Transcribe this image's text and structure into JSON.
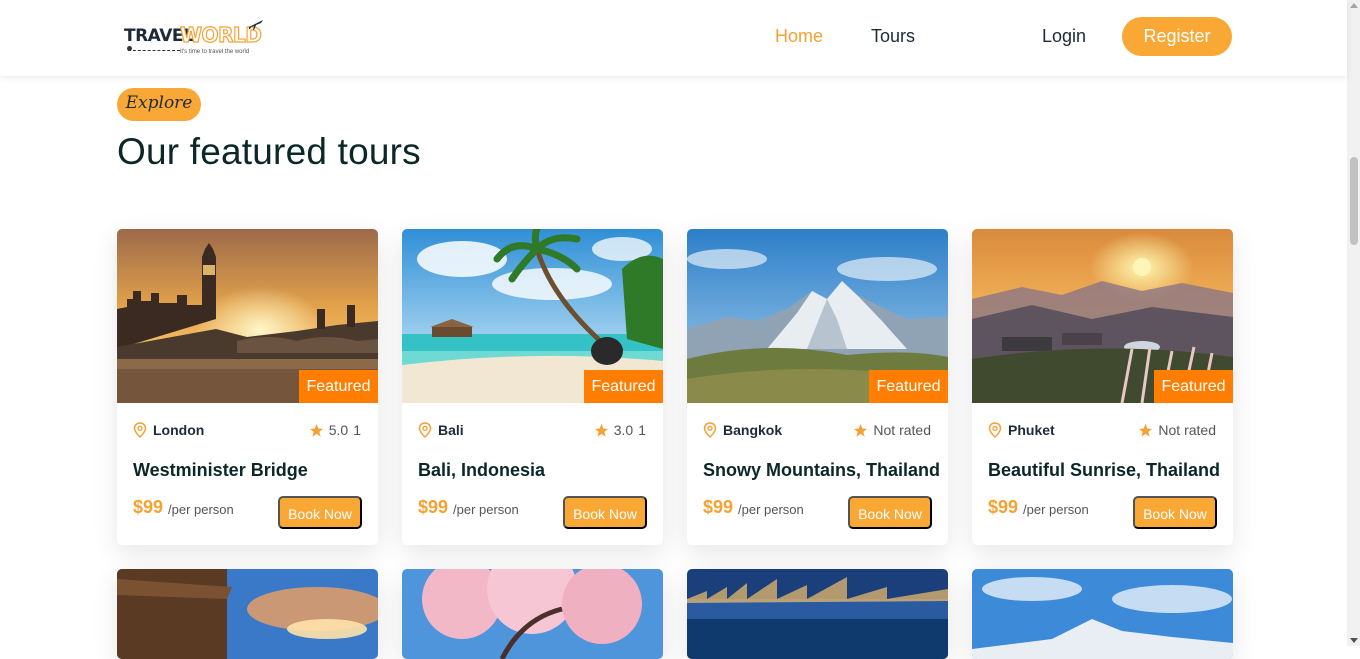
{
  "header": {
    "logo": {
      "travel": "TRAVEL",
      "world": "WORLD",
      "tagline": "it's time to travel the world"
    },
    "nav": [
      {
        "label": "Home",
        "active": true
      },
      {
        "label": "Tours",
        "active": false
      }
    ],
    "login_label": "Login",
    "register_label": "Register"
  },
  "section": {
    "badge": "Explore",
    "title": "Our featured tours"
  },
  "tours": [
    {
      "featured_label": "Featured",
      "city": "London",
      "rating": "5.0",
      "reviews": "1",
      "title": "Westminister Bridge",
      "price": "$99",
      "per": "/per person",
      "book_label": "Book Now"
    },
    {
      "featured_label": "Featured",
      "city": "Bali",
      "rating": "3.0",
      "reviews": "1",
      "title": "Bali, Indonesia",
      "price": "$99",
      "per": "/per person",
      "book_label": "Book Now"
    },
    {
      "featured_label": "Featured",
      "city": "Bangkok",
      "rating": "Not rated",
      "reviews": "",
      "title": "Snowy Mountains, Thailand",
      "price": "$99",
      "per": "/per person",
      "book_label": "Book Now"
    },
    {
      "featured_label": "Featured",
      "city": "Phuket",
      "rating": "Not rated",
      "reviews": "",
      "title": "Beautiful Sunrise, Thailand",
      "price": "$99",
      "per": "/per person",
      "book_label": "Book Now"
    }
  ],
  "colors": {
    "accent": "#f9a836",
    "featured": "#ff7e01",
    "heading": "#0b2727"
  },
  "icons": {
    "location": "map-pin-icon",
    "rating": "star-icon",
    "logo_plane": "airplane-icon"
  }
}
